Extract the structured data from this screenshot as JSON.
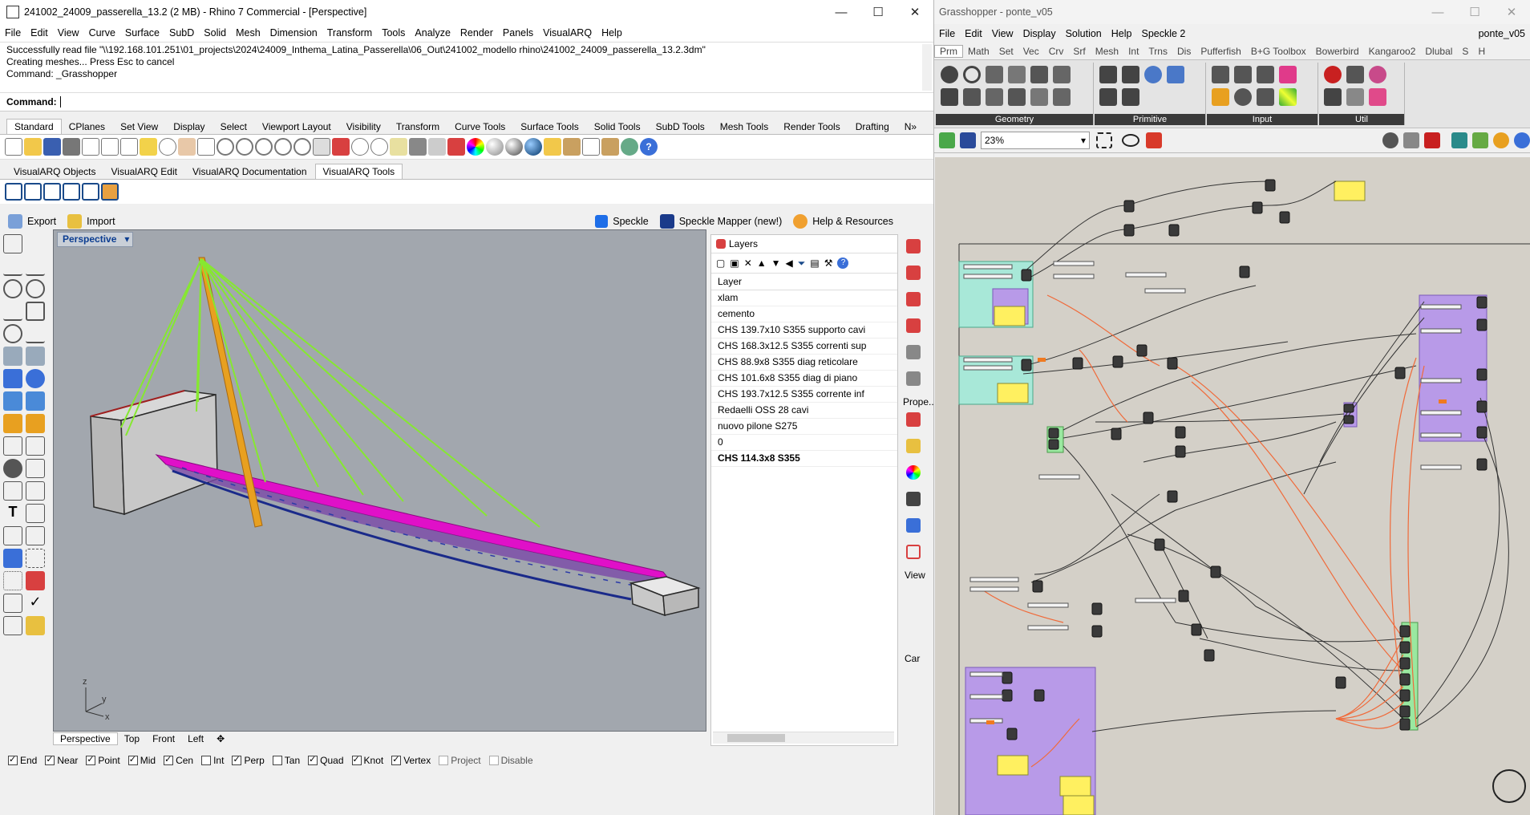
{
  "rhino": {
    "title": "241002_24009_passerella_13.2 (2 MB) - Rhino 7 Commercial - [Perspective]",
    "menu": [
      "File",
      "Edit",
      "View",
      "Curve",
      "Surface",
      "SubD",
      "Solid",
      "Mesh",
      "Dimension",
      "Transform",
      "Tools",
      "Analyze",
      "Render",
      "Panels",
      "VisualARQ",
      "Help"
    ],
    "history": [
      "Successfully read file \"\\\\192.168.101.251\\01_projects\\2024\\24009_Inthema_Latina_Passerella\\06_Out\\241002_modello rhino\\241002_24009_passerella_13.2.3dm\"",
      "Creating meshes... Press Esc to cancel",
      "Command: _Grasshopper"
    ],
    "command_label": "Command:",
    "toolbar_tabs": [
      "Standard",
      "CPlanes",
      "Set View",
      "Display",
      "Select",
      "Viewport Layout",
      "Visibility",
      "Transform",
      "Curve Tools",
      "Surface Tools",
      "Solid Tools",
      "SubD Tools",
      "Mesh Tools",
      "Render Tools",
      "Drafting",
      "N»"
    ],
    "varq_tabs": [
      "VisualARQ Objects",
      "VisualARQ Edit",
      "VisualARQ Documentation",
      "VisualARQ Tools"
    ],
    "plugin_bar": {
      "export": "Export",
      "import": "Import",
      "speckle": "Speckle",
      "speckle_mapper": "Speckle Mapper (new!)",
      "help": "Help & Resources"
    },
    "viewport_name": "Perspective",
    "viewport_tabs": [
      "Perspective",
      "Top",
      "Front",
      "Left"
    ],
    "axes": {
      "x": "x",
      "y": "y",
      "z": "z"
    },
    "layers_panel": {
      "title": "Layers",
      "header": "Layer",
      "rows": [
        "xlam",
        "cemento",
        "CHS 139.7x10 S355 supporto cavi",
        "CHS 168.3x12.5 S355 correnti sup",
        "CHS 88.9x8 S355 diag reticolare",
        "CHS 101.6x8 S355 diag di piano",
        "CHS 193.7x12.5 S355 corrente inf",
        "Redaelli OSS 28 cavi",
        "nuovo pilone S275",
        "0",
        "CHS 114.3x8 S355"
      ],
      "current": "CHS 114.3x8 S355"
    },
    "side_labels": {
      "properties": "Prope...",
      "view": "View",
      "camera": "Car"
    },
    "osnaps": [
      {
        "label": "End",
        "on": true
      },
      {
        "label": "Near",
        "on": true
      },
      {
        "label": "Point",
        "on": true
      },
      {
        "label": "Mid",
        "on": true
      },
      {
        "label": "Cen",
        "on": true
      },
      {
        "label": "Int",
        "on": false
      },
      {
        "label": "Perp",
        "on": true
      },
      {
        "label": "Tan",
        "on": false
      },
      {
        "label": "Quad",
        "on": true
      },
      {
        "label": "Knot",
        "on": true
      },
      {
        "label": "Vertex",
        "on": true
      },
      {
        "label": "Project",
        "on": false
      },
      {
        "label": "Disable",
        "on": false
      }
    ]
  },
  "grasshopper": {
    "title": "Grasshopper - ponte_v05",
    "menu": [
      "File",
      "Edit",
      "View",
      "Display",
      "Solution",
      "Help",
      "Speckle 2"
    ],
    "doc_name": "ponte_v05",
    "tabs": [
      "Prm",
      "Math",
      "Set",
      "Vec",
      "Crv",
      "Srf",
      "Mesh",
      "Int",
      "Trns",
      "Dis",
      "Pufferfish",
      "B+G Toolbox",
      "Bowerbird",
      "Kangaroo2",
      "Dlubal",
      "S",
      "H"
    ],
    "ribbon_groups": [
      "Geometry",
      "Primitive",
      "Input",
      "Util"
    ],
    "zoom": "23%"
  },
  "colors": {
    "deck": "#e010c8",
    "cables": "#86e830",
    "pylon": "#e8a020",
    "viewport_bg": "#a2a7ae",
    "gh_canvas": "#d4d0c8",
    "group_cyan": "#a8e8d8",
    "group_purple": "#b89ae8",
    "group_green": "#9ae8a0",
    "wire_red": "#f06a3a",
    "panel_yellow": "#fff060"
  }
}
